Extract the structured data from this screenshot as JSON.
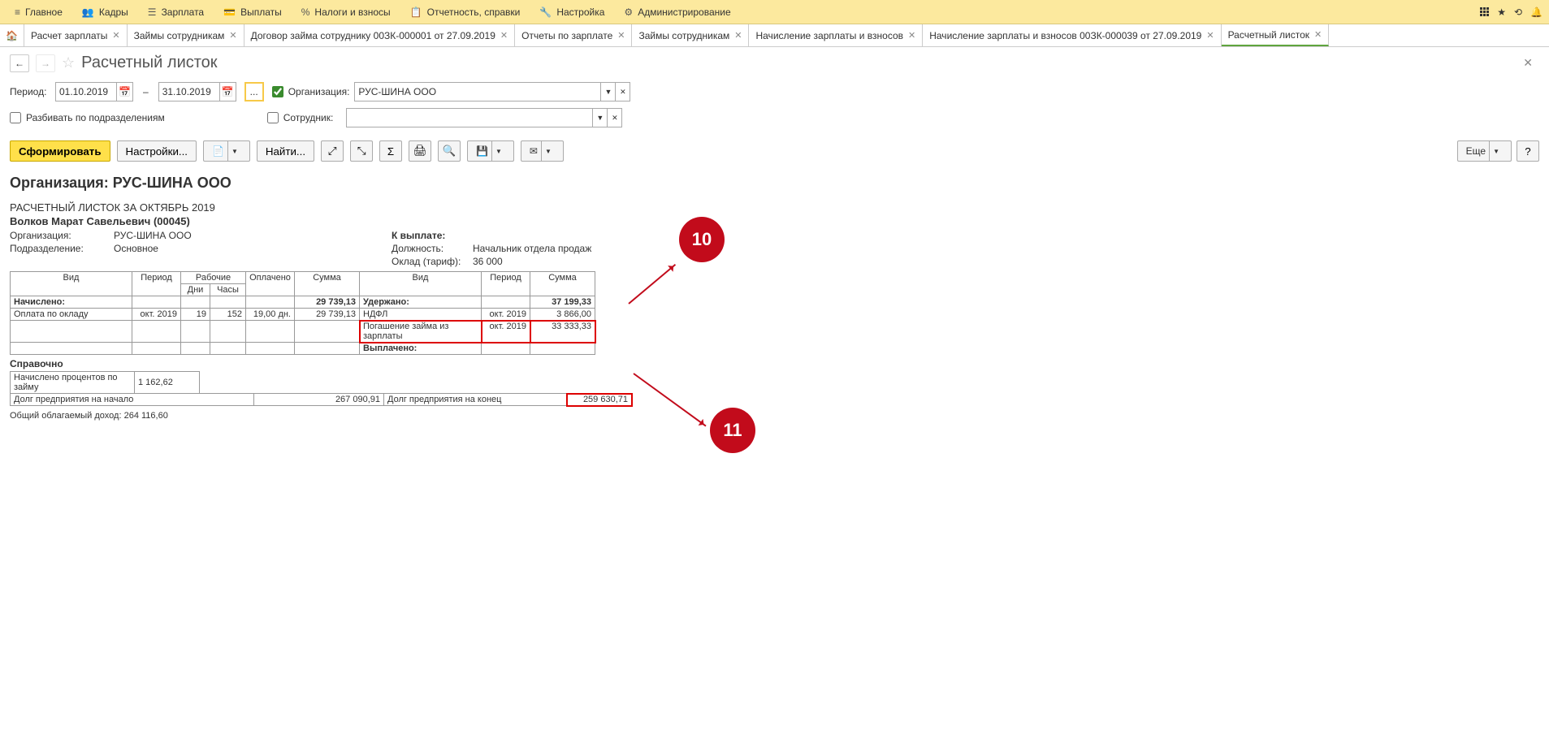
{
  "topmenu": [
    {
      "icon": "≡",
      "label": "Главное"
    },
    {
      "icon": "👥",
      "label": "Кадры"
    },
    {
      "icon": "☰",
      "label": "Зарплата"
    },
    {
      "icon": "💳",
      "label": "Выплаты"
    },
    {
      "icon": "%",
      "label": "Налоги и взносы"
    },
    {
      "icon": "📋",
      "label": "Отчетность, справки"
    },
    {
      "icon": "🔧",
      "label": "Настройка"
    },
    {
      "icon": "⚙",
      "label": "Администрирование"
    }
  ],
  "tabs": [
    "Расчет зарплаты",
    "Займы сотрудникам",
    "Договор займа сотруднику 00ЗК-000001 от 27.09.2019",
    "Отчеты по зарплате",
    "Займы сотрудникам",
    "Начисление зарплаты и взносов",
    "Начисление зарплаты и взносов 00ЗК-000039 от 27.09.2019",
    "Расчетный листок"
  ],
  "header": {
    "title": "Расчетный листок"
  },
  "filters": {
    "period_label": "Период:",
    "date_from": "01.10.2019",
    "date_to": "31.10.2019",
    "org_label": "Организация:",
    "org_value": "РУС-ШИНА ООО",
    "split_label": "Разбивать по подразделениям",
    "emp_label": "Сотрудник:",
    "emp_value": "",
    "ellipsis": "..."
  },
  "toolbar": {
    "form": "Сформировать",
    "settings": "Настройки...",
    "find": "Найти...",
    "more": "Еще"
  },
  "report": {
    "org_title": "Организация: РУС-ШИНА ООО",
    "sheet_title": "РАСЧЕТНЫЙ ЛИСТОК ЗА ОКТЯБРЬ 2019",
    "employee": "Волков Марат Савельевич (00045)",
    "org_line_lbl": "Организация:",
    "org_line_val": "РУС-ШИНА ООО",
    "dept_lbl": "Подразделение:",
    "dept_val": "Основное",
    "pay_lbl": "К выплате:",
    "pay_val": "",
    "pos_lbl": "Должность:",
    "pos_val": "Начальник отдела продаж",
    "rate_lbl": "Оклад (тариф):",
    "rate_val": "36 000",
    "headers": {
      "vid": "Вид",
      "period": "Период",
      "work": "Рабочие",
      "days": "Дни",
      "hours": "Часы",
      "paid": "Оплачено",
      "sum": "Сумма"
    },
    "accrued_label": "Начислено:",
    "accrued_total": "29 739,13",
    "accrued_row": {
      "name": "Оплата по окладу",
      "period": "окт. 2019",
      "days": "19",
      "hours": "152",
      "paid": "19,00 дн.",
      "sum": "29 739,13"
    },
    "withheld_label": "Удержано:",
    "withheld_total": "37 199,33",
    "withheld_rows": [
      {
        "name": "НДФЛ",
        "period": "окт. 2019",
        "sum": "3 866,00"
      },
      {
        "name": "Погашение займа из зарплаты",
        "period": "окт. 2019",
        "sum": "33 333,33"
      }
    ],
    "paid_label": "Выплачено:",
    "ref_label": "Справочно",
    "ref_name": "Начислено процентов по займу",
    "ref_val": "1 162,62",
    "debt_start_lbl": "Долг предприятия на начало",
    "debt_start_val": "267 090,91",
    "debt_end_lbl": "Долг предприятия на конец",
    "debt_end_val": "259 630,71",
    "income_label": "Общий облагаемый доход:",
    "income_val": "264 116,60"
  },
  "callouts": {
    "c10": "10",
    "c11": "11"
  }
}
